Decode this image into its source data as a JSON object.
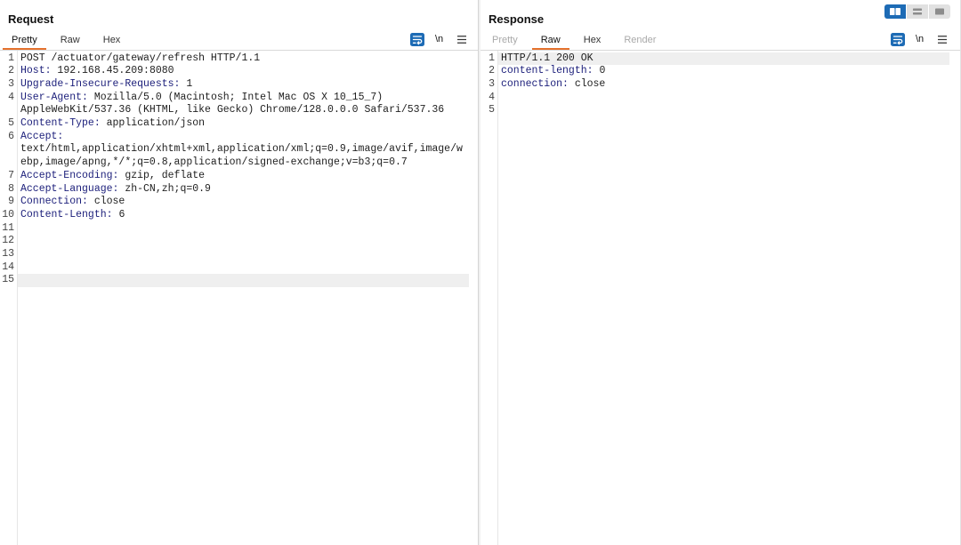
{
  "colors": {
    "accent": "#1d6bb5",
    "tab_underline": "#e5722e",
    "header_name": "#1b1e7a",
    "current_line_bg": "#efefef"
  },
  "view_toggle": [
    {
      "icon": "side-by-side-icon",
      "selected": true
    },
    {
      "icon": "stacked-icon",
      "selected": false
    },
    {
      "icon": "single-pane-icon",
      "selected": false
    }
  ],
  "request": {
    "title": "Request",
    "tabs": [
      {
        "label": "Pretty",
        "selected": true
      },
      {
        "label": "Raw"
      },
      {
        "label": "Hex"
      }
    ],
    "tools": {
      "wrap_icon": "wrap-lines-icon",
      "wrap_lines_on": true,
      "newline_label": "\\n",
      "menu_icon": "menu-icon"
    },
    "current_line": 15,
    "lines": [
      {
        "n": 1,
        "text": "POST /actuator/gateway/refresh HTTP/1.1"
      },
      {
        "n": 2,
        "key": "Host:",
        "val": "192.168.45.209:8080"
      },
      {
        "n": 3,
        "key": "Upgrade-Insecure-Requests:",
        "val": "1"
      },
      {
        "n": 4,
        "key": "User-Agent:",
        "val": "Mozilla/5.0 (Macintosh; Intel Mac OS X 10_15_7)",
        "wrapped": [
          "AppleWebKit/537.36 (KHTML, like Gecko) Chrome/128.0.0.0 Safari/537.36"
        ]
      },
      {
        "n": 5,
        "key": "Content-Type:",
        "val": "application/json"
      },
      {
        "n": 6,
        "key": "Accept:",
        "wrapped": [
          "text/html,application/xhtml+xml,application/xml;q=0.9,image/avif,image/w",
          "ebp,image/apng,*/*;q=0.8,application/signed-exchange;v=b3;q=0.7"
        ]
      },
      {
        "n": 7,
        "key": "Accept-Encoding:",
        "val": "gzip, deflate"
      },
      {
        "n": 8,
        "key": "Accept-Language:",
        "val": "zh-CN,zh;q=0.9"
      },
      {
        "n": 9,
        "key": "Connection:",
        "val": "close"
      },
      {
        "n": 10,
        "key": "Content-Length:",
        "val": "6"
      },
      {
        "n": 11
      },
      {
        "n": 12
      },
      {
        "n": 13
      },
      {
        "n": 14
      },
      {
        "n": 15
      }
    ]
  },
  "response": {
    "title": "Response",
    "tabs": [
      {
        "label": "Pretty",
        "disabled": true
      },
      {
        "label": "Raw",
        "selected": true
      },
      {
        "label": "Hex"
      },
      {
        "label": "Render",
        "disabled": true
      }
    ],
    "tools": {
      "wrap_icon": "wrap-lines-icon",
      "wrap_lines_on": true,
      "newline_label": "\\n",
      "menu_icon": "menu-icon"
    },
    "current_line": 1,
    "lines": [
      {
        "n": 1,
        "text": "HTTP/1.1 200 OK"
      },
      {
        "n": 2,
        "key": "content-length:",
        "val": "0"
      },
      {
        "n": 3,
        "key": "connection:",
        "val": "close"
      },
      {
        "n": 4
      },
      {
        "n": 5
      }
    ]
  }
}
